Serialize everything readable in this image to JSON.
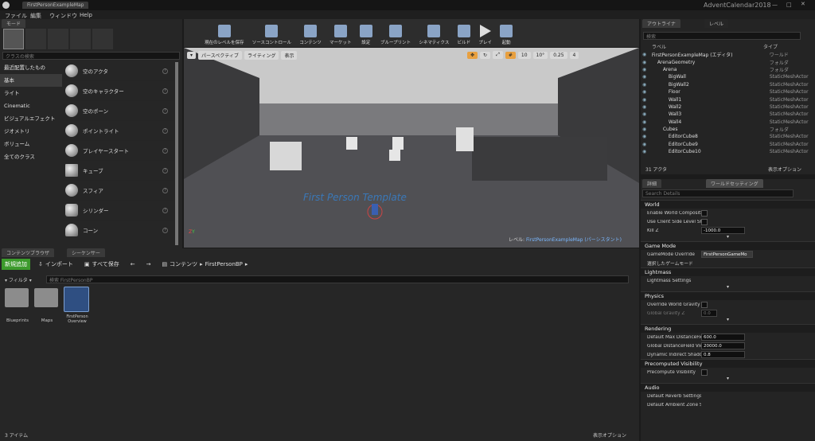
{
  "window": {
    "tab": "FirstPersonExampleMap",
    "project": "AdventCalendar2018"
  },
  "menu": [
    "ファイル",
    "編集",
    "ウィンドウ",
    "Help"
  ],
  "modes": {
    "tab": "モード",
    "search_placeholder": "クラスの検索",
    "categories": [
      "最近配置したもの",
      "基本",
      "ライト",
      "Cinematic",
      "ビジュアルエフェクト",
      "ジオメトリ",
      "ボリューム",
      "全てのクラス"
    ],
    "items": [
      "空のアクタ",
      "空のキャラクター",
      "空のポーン",
      "ポイントライト",
      "プレイヤースタート",
      "キューブ",
      "スフィア",
      "シリンダー",
      "コーン"
    ]
  },
  "toolbar": [
    "現在のレベルを保存",
    "ソースコントロール",
    "コンテンツ",
    "マーケット",
    "設定",
    "ブループリント",
    "シネマティクス",
    "ビルド",
    "プレイ",
    "起動"
  ],
  "viewport": {
    "perspective": "パースペクティブ",
    "lighting": "ライティング",
    "show": "表示",
    "snap_grid": "10",
    "snap_rot": "10°",
    "snap_scale": "0.25",
    "cam_speed": "4",
    "floor_text": "First Person Template",
    "level_label": "レベル:",
    "level_name": "FirstPersonExampleMap (パーシスタント)"
  },
  "outliner": {
    "tab1": "アウトライナ",
    "tab2": "レベル",
    "search_placeholder": "検索",
    "col_label": "ラベル",
    "col_type": "タイプ",
    "rows": [
      {
        "name": "FirstPersonExampleMap (エディタ)",
        "type": "ワールド",
        "indent": 0
      },
      {
        "name": "ArenaGeometry",
        "type": "フォルダ",
        "indent": 1
      },
      {
        "name": "Arena",
        "type": "フォルダ",
        "indent": 2
      },
      {
        "name": "BigWall",
        "type": "StaticMeshActor",
        "indent": 3
      },
      {
        "name": "BigWall2",
        "type": "StaticMeshActor",
        "indent": 3
      },
      {
        "name": "Floor",
        "type": "StaticMeshActor",
        "indent": 3
      },
      {
        "name": "Wall1",
        "type": "StaticMeshActor",
        "indent": 3
      },
      {
        "name": "Wall2",
        "type": "StaticMeshActor",
        "indent": 3
      },
      {
        "name": "Wall3",
        "type": "StaticMeshActor",
        "indent": 3
      },
      {
        "name": "Wall4",
        "type": "StaticMeshActor",
        "indent": 3
      },
      {
        "name": "Cubes",
        "type": "フォルダ",
        "indent": 2
      },
      {
        "name": "EditorCube8",
        "type": "StaticMeshActor",
        "indent": 3
      },
      {
        "name": "EditorCube9",
        "type": "StaticMeshActor",
        "indent": 3
      },
      {
        "name": "EditorCube10",
        "type": "StaticMeshActor",
        "indent": 3
      }
    ],
    "count": "31 アクタ",
    "view_options": "表示オプション"
  },
  "details": {
    "tab1": "詳細",
    "tab2": "ワールドセッティング",
    "search_placeholder": "Search Details",
    "world": {
      "title": "World",
      "p1": "Enable World Compositio",
      "p2": "Use Client Side Level Sh",
      "p3": "Kill Z",
      "killz": "-1000.0"
    },
    "gamemode": {
      "title": "Game Mode",
      "p1": "GameMode Override",
      "value": "FirstPersonGameMo",
      "p2": "選択したゲームモード"
    },
    "lightmass": {
      "title": "Lightmass",
      "p1": "Lightmass Settings"
    },
    "physics": {
      "title": "Physics",
      "p1": "Override World Gravity",
      "p2": "Global Gravity Z",
      "gz": "0.0"
    },
    "rendering": {
      "title": "Rendering",
      "p1": "Default Max DistanceFie",
      "v1": "600.0",
      "p2": "Global DistanceField Vie",
      "v2": "20000.0",
      "p3": "Dynamic Indirect Shado",
      "v3": "0.8"
    },
    "precomputed": {
      "title": "Precomputed Visibility",
      "p1": "Precompute Visibility"
    },
    "audio": {
      "title": "Audio",
      "p1": "Default Reverb Settings",
      "p2": "Default Ambient Zone Se"
    }
  },
  "content": {
    "tab1": "コンテンツブラウザ",
    "tab2": "シーケンサー",
    "add_new": "新規追加",
    "import": "インポート",
    "save_all": "すべて保存",
    "path1": "コンテンツ",
    "path2": "FirstPersonBP",
    "filter": "フィルタ",
    "search_placeholder": "検索 FirstPersonBP",
    "assets": [
      "Blueprints",
      "Maps",
      "FirstPerson Overview"
    ],
    "count": "3 アイテム",
    "view_options": "表示オプション"
  }
}
